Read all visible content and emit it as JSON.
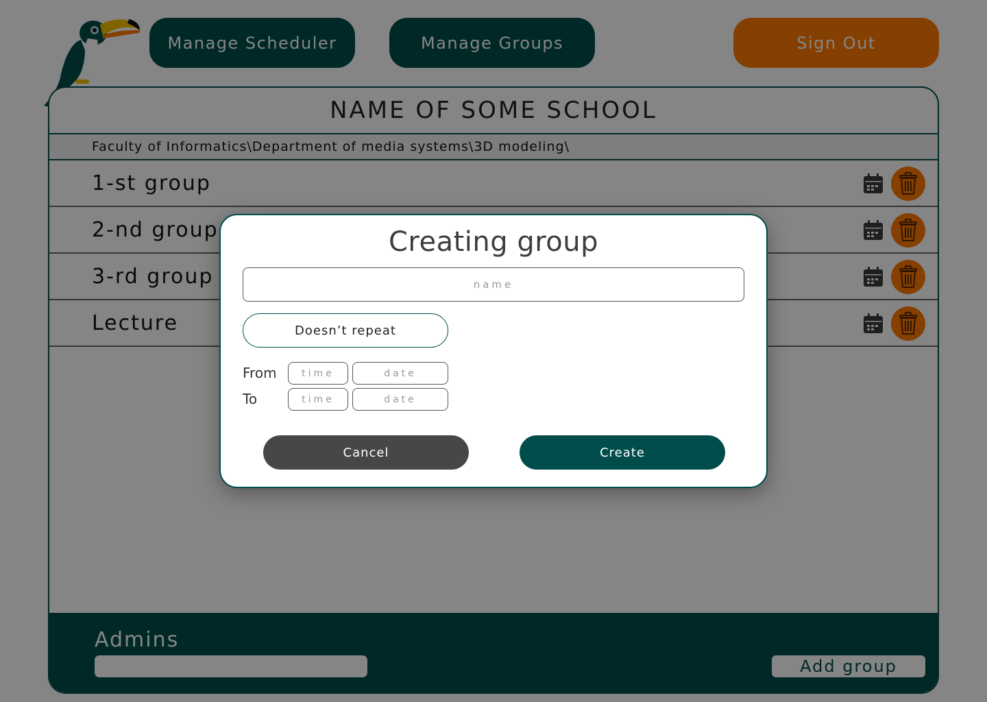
{
  "header": {
    "manage_scheduler": "Manage Scheduler",
    "manage_groups": "Manage Groups",
    "sign_out": "Sign Out"
  },
  "logo": {
    "icon": "toucan-icon"
  },
  "school": {
    "name": "NAME OF SOME SCHOOL",
    "breadcrumb": "Faculty of Informatics\\Department of media systems\\3D modeling\\"
  },
  "groups": [
    {
      "name": "1-st group"
    },
    {
      "name": "2-nd group"
    },
    {
      "name": "3-rd group"
    },
    {
      "name": "Lecture"
    }
  ],
  "footer": {
    "admins_label": "Admins",
    "add_group": "Add group"
  },
  "modal": {
    "title": "Creating group",
    "name_placeholder": "name",
    "repeat_value": "Doesn’t repeat",
    "from_label": "From",
    "to_label": "To",
    "time_placeholder": "time",
    "date_placeholder": "date",
    "cancel": "Cancel",
    "create": "Create"
  },
  "colors": {
    "primary": "#004d4b",
    "accent": "#ff7a00",
    "cancel": "#474747",
    "overlay": "rgba(0,0,0,0.48)"
  }
}
